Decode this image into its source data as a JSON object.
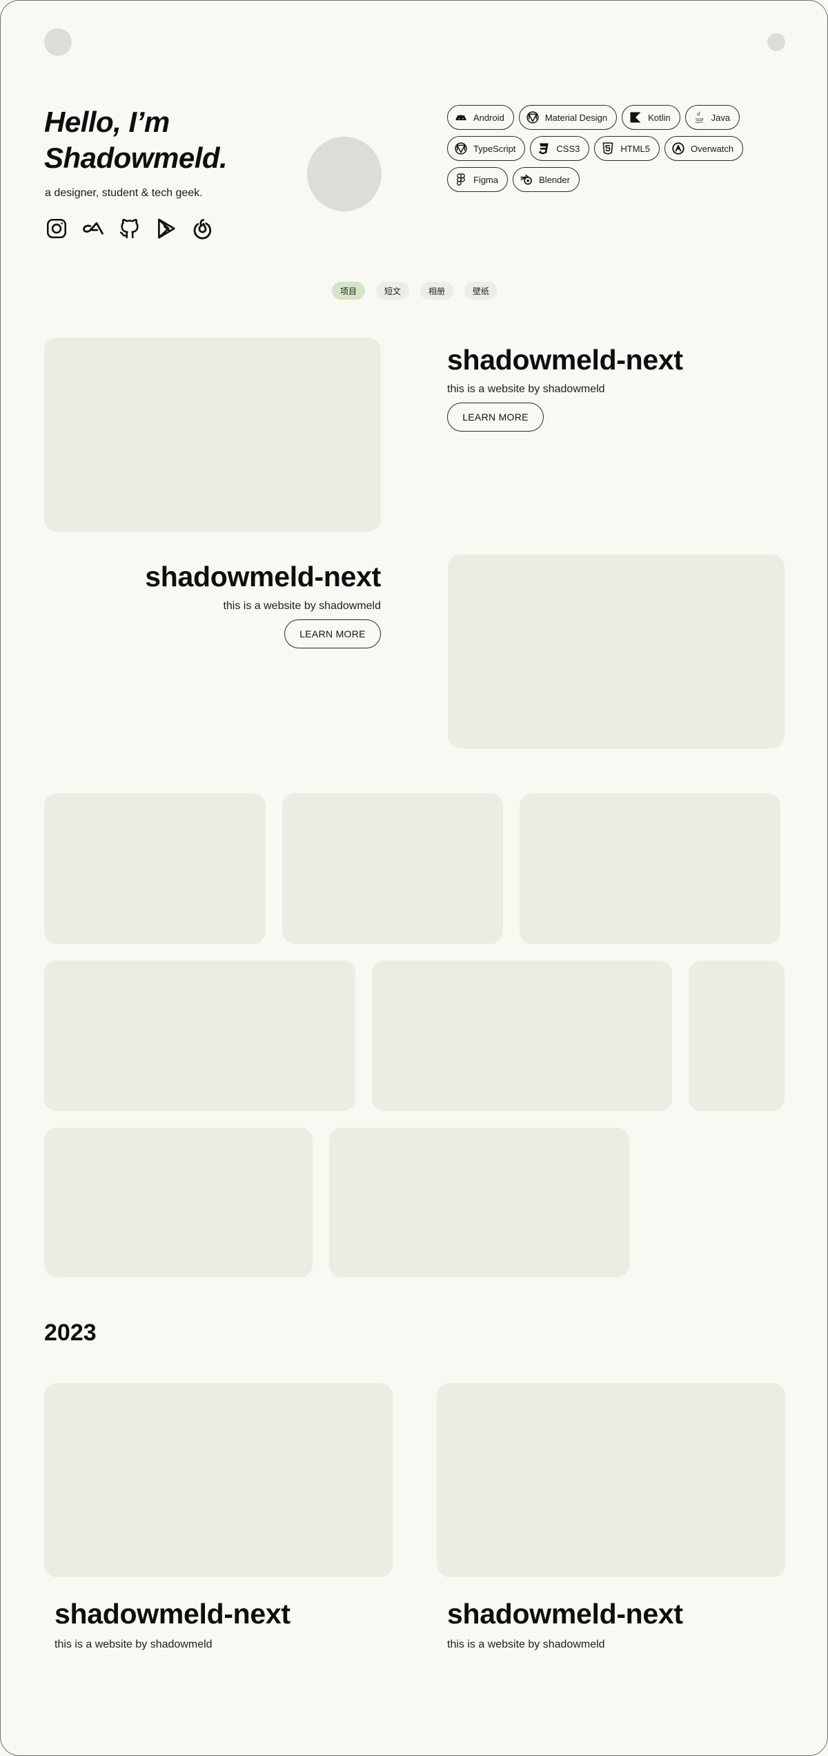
{
  "hero": {
    "greeting": "Hello, I’m",
    "name": "Shadowmeld.",
    "tagline": "a designer, student & tech geek."
  },
  "social_icons": [
    "instagram-icon",
    "coolapk-icon",
    "github-icon",
    "google-play-icon",
    "netease-music-icon"
  ],
  "skills": [
    {
      "label": "Android",
      "icon": "android-icon"
    },
    {
      "label": "Material Design",
      "icon": "material-design-icon"
    },
    {
      "label": "Kotlin",
      "icon": "kotlin-icon"
    },
    {
      "label": "Java",
      "icon": "java-icon"
    },
    {
      "label": "TypeScript",
      "icon": "typescript-icon"
    },
    {
      "label": "CSS3",
      "icon": "css3-icon"
    },
    {
      "label": "HTML5",
      "icon": "html5-icon"
    },
    {
      "label": "Overwatch",
      "icon": "overwatch-icon"
    },
    {
      "label": "Figma",
      "icon": "figma-icon"
    },
    {
      "label": "Blender",
      "icon": "blender-icon"
    }
  ],
  "tabs": [
    {
      "label": "项目",
      "active": true
    },
    {
      "label": "短文",
      "active": false
    },
    {
      "label": "相册",
      "active": false
    },
    {
      "label": "壁纸",
      "active": false
    }
  ],
  "featured": [
    {
      "title": "shadowmeld-next",
      "description": "this is a website by shadowmeld",
      "button": "LEARN MORE"
    },
    {
      "title": "shadowmeld-next",
      "description": "this is a website by shadowmeld",
      "button": "LEARN MORE"
    }
  ],
  "year_section": {
    "year": "2023",
    "posts": [
      {
        "title": "shadowmeld-next",
        "description": "this is a website by shadowmeld"
      },
      {
        "title": "shadowmeld-next",
        "description": "this is a website by shadowmeld"
      }
    ]
  }
}
